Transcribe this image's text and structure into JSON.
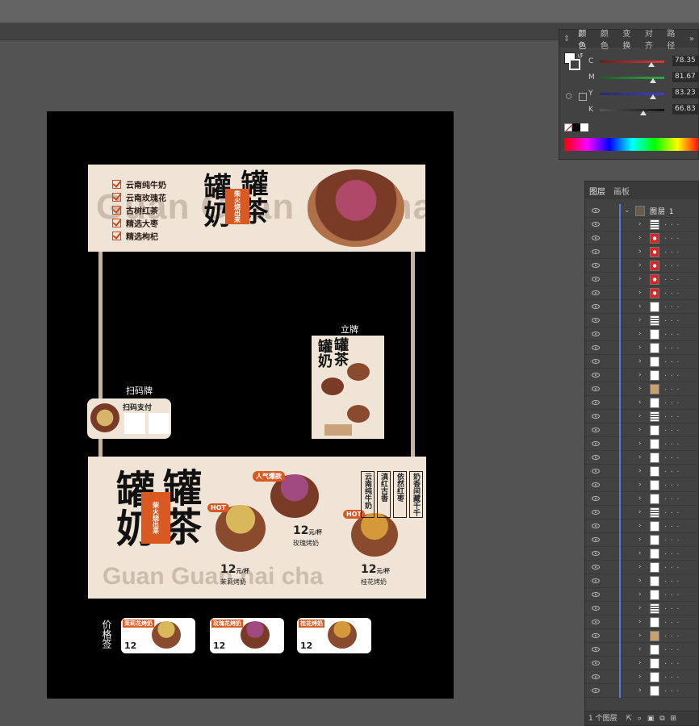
{
  "color_panel": {
    "tabs": [
      "颜色",
      "颜色",
      "变换",
      "对齐",
      "路径"
    ],
    "more": "»",
    "sliders": [
      {
        "label": "C",
        "value": "78.35",
        "color_from": "#6a1f1f",
        "color_to": "#d23c3c"
      },
      {
        "label": "M",
        "value": "81.67",
        "color_from": "#1e5a2a",
        "color_to": "#33aa44"
      },
      {
        "label": "Y",
        "value": "83.23",
        "color_from": "#2a2a6a",
        "color_to": "#3d3dcc"
      },
      {
        "label": "K",
        "value": "66.83",
        "color_from": "#555555",
        "color_to": "#111111"
      }
    ],
    "fill_color": "#3a1a14"
  },
  "layers_panel": {
    "tabs": [
      "图层",
      "画板"
    ],
    "top_layer": "图层 1",
    "ellipsis": ". . .",
    "footer": "1 个图层",
    "row_count": 36
  },
  "artwork": {
    "brand_left": "罐奶",
    "brand_right": "罐茶",
    "stamp": "柴火烧出来",
    "ghost_text": "Guan Guan nai cha",
    "checklist": [
      "云南纯牛奶",
      "云南玫瑰花",
      "古树红茶",
      "精选大枣",
      "精选枸杞"
    ],
    "label_stand": "立牌",
    "label_qr": "扫码牌",
    "qr_title": "扫码支付",
    "label_price": "价格签",
    "counter": {
      "badge_popular": "人气爆款",
      "badge_hot_1": "HOT",
      "badge_hot_2": "HOT",
      "price_1": "12",
      "unit_1": "元/杯",
      "name_1": "茉莉烤奶",
      "price_2": "12",
      "unit_2": "元/杯",
      "name_2": "玫瑰烤奶",
      "price_3": "12",
      "unit_3": "元/杯",
      "name_3": "桂花烤奶",
      "vertical_cols": [
        "奶香间藏千千",
        "依然红枣",
        "滇红古香",
        "云南纯牛奶"
      ]
    },
    "price_tags": [
      "茉莉花烤奶",
      "玫瑰花烤奶",
      "桂花烤奶"
    ],
    "price_tag_value": "12"
  }
}
